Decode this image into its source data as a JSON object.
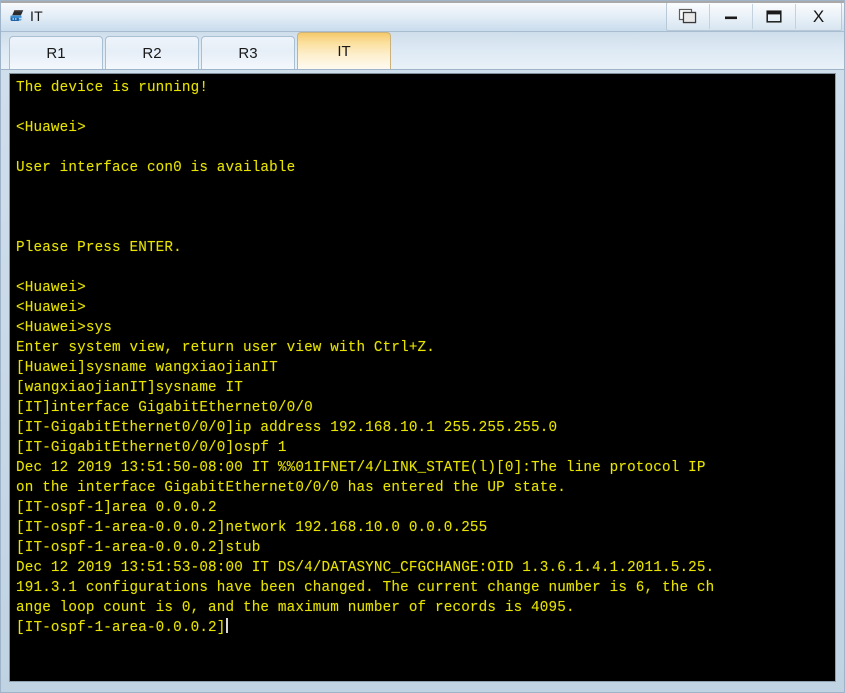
{
  "window": {
    "title": "IT",
    "icon": "router-device-icon",
    "controls": [
      {
        "name": "restore-windows-button",
        "label": "❐",
        "icon": "cascade-windows-icon"
      },
      {
        "name": "minimize-button",
        "label": "—",
        "icon": "minimize-icon"
      },
      {
        "name": "maximize-button",
        "label": "❐",
        "icon": "maximize-icon"
      },
      {
        "name": "close-button",
        "label": "X",
        "icon": "close-icon"
      }
    ]
  },
  "tabs": [
    {
      "label": "R1",
      "active": false
    },
    {
      "label": "R2",
      "active": false
    },
    {
      "label": "R3",
      "active": false
    },
    {
      "label": "IT",
      "active": true
    }
  ],
  "colors": {
    "terminal_background": "#000000",
    "terminal_text": "#e8e400",
    "active_tab_accent": "#f5c96a",
    "window_chrome": "#c6d7e6",
    "cursor": "#d8d8d8"
  },
  "terminal": {
    "lines": [
      "The device is running!",
      "",
      "<Huawei>",
      "",
      "User interface con0 is available",
      "",
      "",
      "",
      "Please Press ENTER.",
      "",
      "<Huawei>",
      "<Huawei>",
      "<Huawei>sys",
      "Enter system view, return user view with Ctrl+Z.",
      "[Huawei]sysname wangxiaojianIT",
      "[wangxiaojianIT]sysname IT",
      "[IT]interface GigabitEthernet0/0/0",
      "[IT-GigabitEthernet0/0/0]ip address 192.168.10.1 255.255.255.0",
      "[IT-GigabitEthernet0/0/0]ospf 1",
      "Dec 12 2019 13:51:50-08:00 IT %%01IFNET/4/LINK_STATE(l)[0]:The line protocol IP",
      "on the interface GigabitEthernet0/0/0 has entered the UP state.",
      "[IT-ospf-1]area 0.0.0.2",
      "[IT-ospf-1-area-0.0.0.2]network 192.168.10.0 0.0.0.255",
      "[IT-ospf-1-area-0.0.0.2]stub",
      "Dec 12 2019 13:51:53-08:00 IT DS/4/DATASYNC_CFGCHANGE:OID 1.3.6.1.4.1.2011.5.25.",
      "191.3.1 configurations have been changed. The current change number is 6, the ch",
      "ange loop count is 0, and the maximum number of records is 4095."
    ],
    "prompt_line": "[IT-ospf-1-area-0.0.0.2]"
  }
}
